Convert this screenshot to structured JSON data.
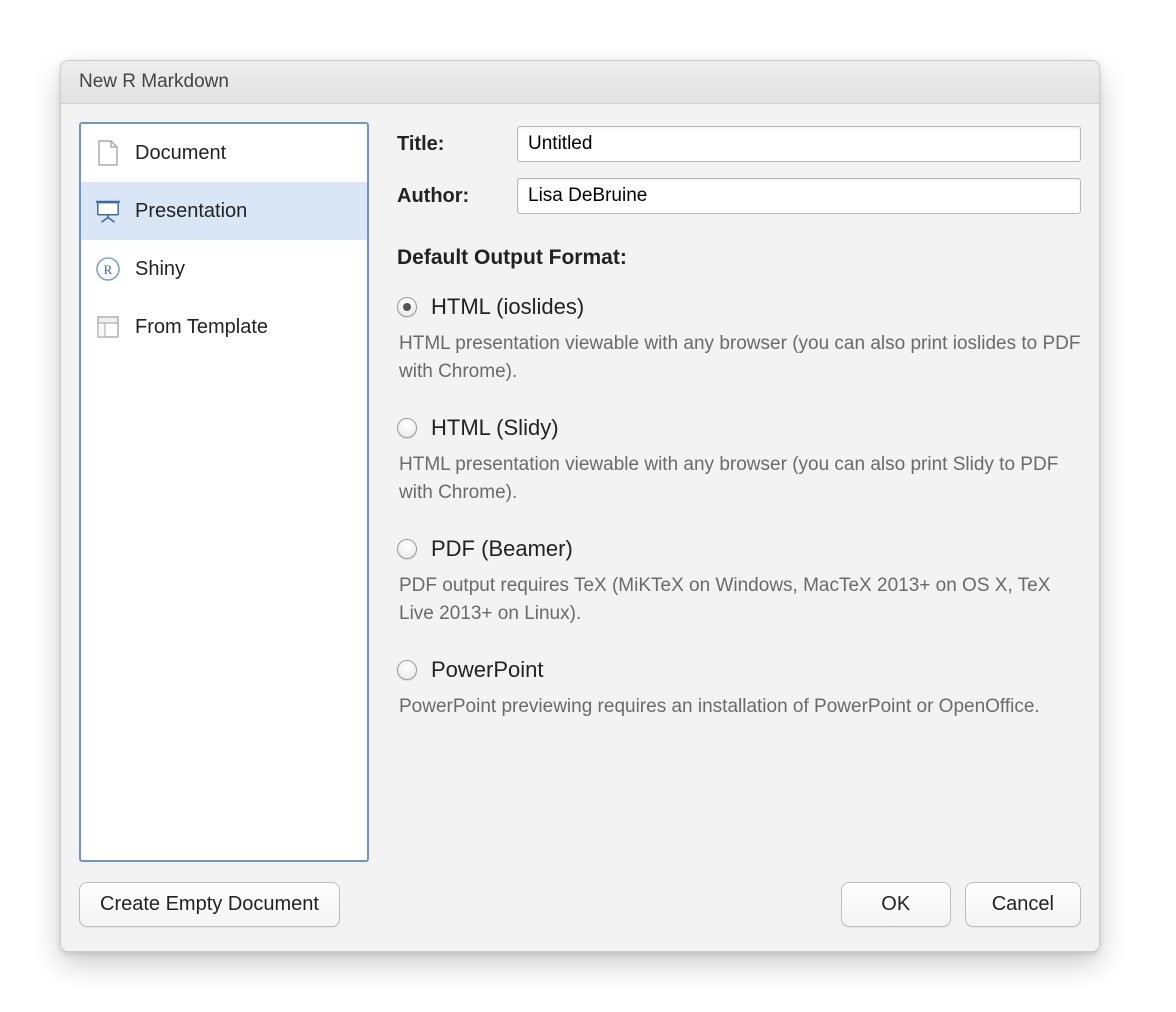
{
  "dialog": {
    "title": "New R Markdown"
  },
  "sidebar": {
    "items": [
      {
        "label": "Document"
      },
      {
        "label": "Presentation"
      },
      {
        "label": "Shiny"
      },
      {
        "label": "From Template"
      }
    ]
  },
  "fields": {
    "title_label": "Title:",
    "title_value": "Untitled",
    "author_label": "Author:",
    "author_value": "Lisa DeBruine"
  },
  "section_heading": "Default Output Format:",
  "options": [
    {
      "title": "HTML (ioslides)",
      "desc": "HTML presentation viewable with any browser (you can also print ioslides to PDF with Chrome)."
    },
    {
      "title": "HTML (Slidy)",
      "desc": "HTML presentation viewable with any browser (you can also print Slidy to PDF with Chrome)."
    },
    {
      "title": "PDF (Beamer)",
      "desc": "PDF output requires TeX (MiKTeX on Windows, MacTeX 2013+ on OS X, TeX Live 2013+ on Linux)."
    },
    {
      "title": "PowerPoint",
      "desc": "PowerPoint previewing requires an installation of PowerPoint or OpenOffice."
    }
  ],
  "buttons": {
    "create_empty": "Create Empty Document",
    "ok": "OK",
    "cancel": "Cancel"
  }
}
